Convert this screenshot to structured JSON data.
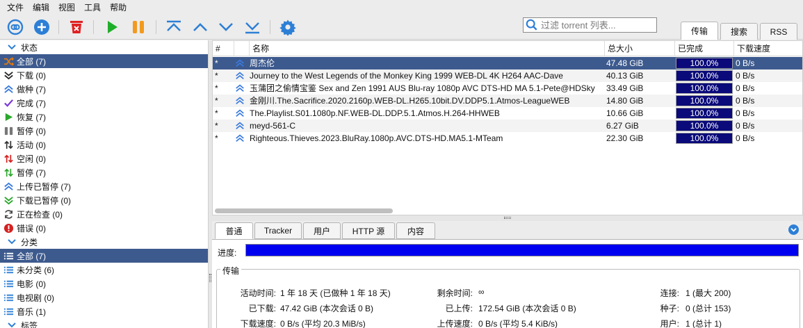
{
  "menu": [
    "文件",
    "编辑",
    "视图",
    "工具",
    "帮助"
  ],
  "toolbar": {
    "icons": [
      "link-icon",
      "add-icon",
      "delete-icon",
      "resume-icon",
      "pause-icon",
      "move-top-icon",
      "move-up-icon",
      "move-down-icon",
      "move-bottom-icon",
      "settings-icon"
    ]
  },
  "filter": {
    "placeholder": "过滤 torrent 列表..."
  },
  "right_tabs": [
    "传输",
    "搜索",
    "RSS"
  ],
  "sidebar": {
    "status_title": "状态",
    "status_items": [
      {
        "label": "全部 (7)",
        "icon": "shuffle-icon",
        "color": "#e07a10",
        "selected": true
      },
      {
        "label": "下载 (0)",
        "icon": "download-icon",
        "color": "#2a2a2a"
      },
      {
        "label": "做种 (7)",
        "icon": "upload-icon",
        "color": "#3a7be0"
      },
      {
        "label": "完成 (7)",
        "icon": "check-icon",
        "color": "#7a3ad6"
      },
      {
        "label": "恢复 (7)",
        "icon": "play-icon",
        "color": "#2aa82a"
      },
      {
        "label": "暂停 (0)",
        "icon": "pause-icon",
        "color": "#777777"
      },
      {
        "label": "活动 (0)",
        "icon": "updown-icon",
        "color": "#333333"
      },
      {
        "label": "空闲 (0)",
        "icon": "updown-red-icon",
        "color": "#d62020"
      },
      {
        "label": "暂停 (7)",
        "icon": "updown-green-icon",
        "color": "#2aa82a"
      },
      {
        "label": "上传已暂停 (7)",
        "icon": "upload-paused-icon",
        "color": "#3a7be0"
      },
      {
        "label": "下载已暂停 (0)",
        "icon": "download-paused-icon",
        "color": "#2aa82a"
      },
      {
        "label": "正在检查 (0)",
        "icon": "refresh-icon",
        "color": "#444444"
      },
      {
        "label": "错误 (0)",
        "icon": "error-icon",
        "color": "#d62020"
      }
    ],
    "category_title": "分类",
    "category_items": [
      {
        "label": "全部 (7)",
        "selected": true
      },
      {
        "label": "未分类 (6)"
      },
      {
        "label": "电影 (0)"
      },
      {
        "label": "电视剧 (0)"
      },
      {
        "label": "音乐 (1)"
      }
    ],
    "tag_title": "标签"
  },
  "torrents": {
    "columns": [
      "#",
      "名称",
      "总大小",
      "已完成",
      "下载速度"
    ],
    "rows": [
      {
        "num": "*",
        "name": "周杰伦",
        "size": "47.48 GiB",
        "done": "100.0%",
        "speed": "0 B/s"
      },
      {
        "num": "*",
        "name": "Journey to the West Legends of the Monkey King 1999 WEB-DL 4K H264 AAC-Dave",
        "size": "40.13 GiB",
        "done": "100.0%",
        "speed": "0 B/s"
      },
      {
        "num": "*",
        "name": "玉蒲团之偷情宝鉴 Sex and Zen 1991 AUS Blu-ray 1080p AVC DTS-HD MA 5.1-Pete@HDSky",
        "size": "33.49 GiB",
        "done": "100.0%",
        "speed": "0 B/s"
      },
      {
        "num": "*",
        "name": "金刚川.The.Sacrifice.2020.2160p.WEB-DL.H265.10bit.DV.DDP5.1.Atmos-LeagueWEB",
        "size": "14.80 GiB",
        "done": "100.0%",
        "speed": "0 B/s"
      },
      {
        "num": "*",
        "name": "The.Playlist.S01.1080p.NF.WEB-DL.DDP.5.1.Atmos.H.264-HHWEB",
        "size": "10.66 GiB",
        "done": "100.0%",
        "speed": "0 B/s"
      },
      {
        "num": "*",
        "name": "meyd-561-C",
        "size": "6.27 GiB",
        "done": "100.0%",
        "speed": "0 B/s"
      },
      {
        "num": "*",
        "name": "Righteous.Thieves.2023.BluRay.1080p.AVC.DTS-HD.MA5.1-MTeam",
        "size": "22.30 GiB",
        "done": "100.0%",
        "speed": "0 B/s"
      }
    ],
    "selected_row": 0
  },
  "detail": {
    "tabs": [
      "普通",
      "Tracker",
      "用户",
      "HTTP 源",
      "内容"
    ],
    "progress_label": "进度:",
    "progress": 1.0,
    "transfer_title": "传输",
    "fields": {
      "active_time_label": "活动时间:",
      "active_time": "1 年 18 天 (已做种 1 年 18 天)",
      "remaining_label": "剩余时间:",
      "remaining": "∞",
      "connections_label": "连接:",
      "connections": "1 (最大 200)",
      "downloaded_label": "已下载:",
      "downloaded": "47.42 GiB (本次会话 0 B)",
      "uploaded_label": "已上传:",
      "uploaded": "172.54 GiB (本次会话 0 B)",
      "seeds_label": "种子:",
      "seeds": "0 (总计 153)",
      "dl_speed_label": "下载速度:",
      "dl_speed": "0 B/s (平均 20.3 MiB/s)",
      "ul_speed_label": "上传速度:",
      "ul_speed": "0 B/s (平均 5.4 KiB/s)",
      "peers_label": "用户:",
      "peers": "1 (总计 1)"
    }
  },
  "colors": {
    "accent": "#2d7fd6",
    "selection": "#3d5a8e",
    "progress": "#0000f0"
  }
}
